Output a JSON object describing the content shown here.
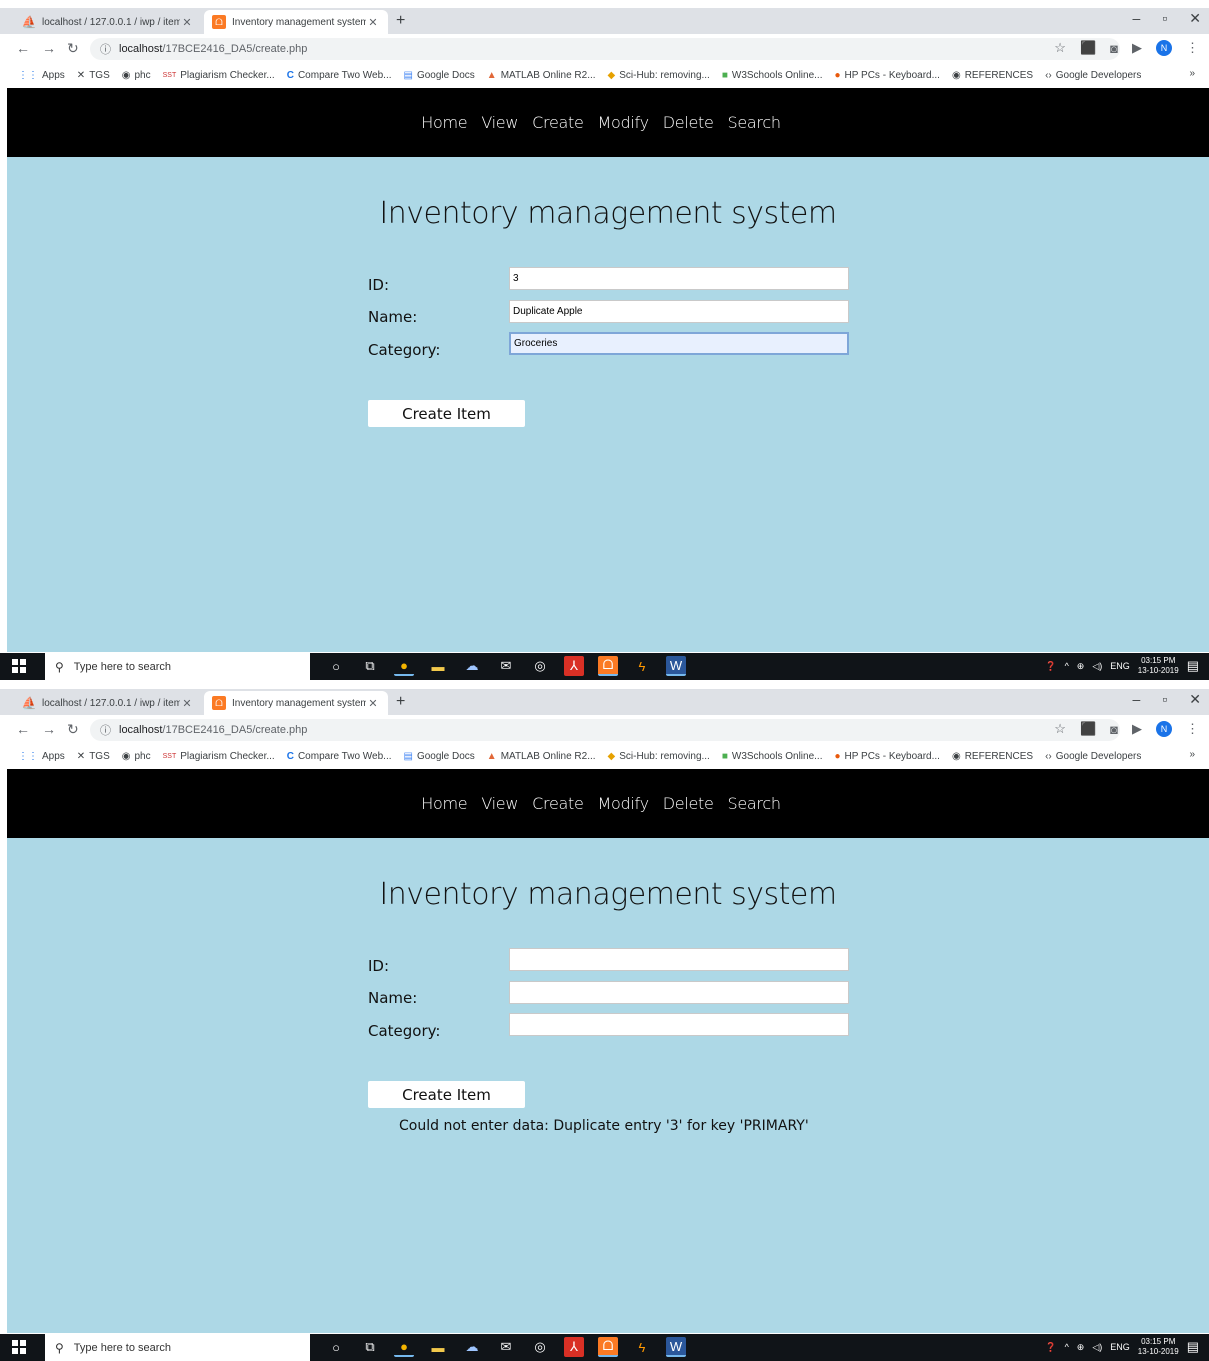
{
  "screens": [
    {
      "browser": {
        "tabs": [
          {
            "title": "localhost / 127.0.0.1 / iwp / items",
            "active": false
          },
          {
            "title": "Inventory management system",
            "active": true
          }
        ],
        "url_host": "localhost",
        "url_path": "/17BCE2416_DA5/create.php",
        "profile_initial": "N"
      },
      "page": {
        "title": "Inventory management system",
        "fields": [
          {
            "label": "ID:",
            "value": "3"
          },
          {
            "label": "Name:",
            "value": "Duplicate Apple"
          },
          {
            "label": "Category:",
            "value": "Groceries"
          }
        ],
        "submit_label": "Create Item",
        "message": ""
      },
      "clock": {
        "time": "03:15 PM",
        "date": "13-10-2019"
      }
    },
    {
      "browser": {
        "tabs": [
          {
            "title": "localhost / 127.0.0.1 / iwp / items",
            "active": false
          },
          {
            "title": "Inventory management system",
            "active": true
          }
        ],
        "url_host": "localhost",
        "url_path": "/17BCE2416_DA5/create.php",
        "profile_initial": "N"
      },
      "page": {
        "title": "Inventory management system",
        "fields": [
          {
            "label": "ID:",
            "value": ""
          },
          {
            "label": "Name:",
            "value": ""
          },
          {
            "label": "Category:",
            "value": ""
          }
        ],
        "submit_label": "Create Item",
        "message": "Could not enter data: Duplicate entry '3' for key 'PRIMARY'"
      },
      "clock": {
        "time": "03:15 PM",
        "date": "13-10-2019"
      }
    }
  ],
  "bookmarks": [
    {
      "label": "Apps",
      "icon": "apps-grid-icon"
    },
    {
      "label": "TGS",
      "icon": "tools-icon"
    },
    {
      "label": "phc",
      "icon": "globe-icon"
    },
    {
      "label": "Plagiarism Checker...",
      "icon": "sst-icon"
    },
    {
      "label": "Compare Two Web...",
      "icon": "c-logo-icon"
    },
    {
      "label": "Google Docs",
      "icon": "docs-icon"
    },
    {
      "label": "MATLAB Online R2...",
      "icon": "matlab-icon"
    },
    {
      "label": "Sci-Hub: removing...",
      "icon": "scihub-icon"
    },
    {
      "label": "W3Schools Online...",
      "icon": "w3schools-icon"
    },
    {
      "label": "HP PCs - Keyboard...",
      "icon": "hp-icon"
    },
    {
      "label": "REFERENCES",
      "icon": "globe-icon"
    },
    {
      "label": "Google Developers",
      "icon": "developers-icon"
    }
  ],
  "nav_links": [
    "Home",
    "View",
    "Create",
    "Modify",
    "Delete",
    "Search"
  ],
  "taskbar": {
    "search_placeholder": "Type here to search",
    "language": "ENG"
  },
  "colors": {
    "page_background": "#add8e6",
    "nav_background": "#000000",
    "taskbar_background": "#101418"
  }
}
